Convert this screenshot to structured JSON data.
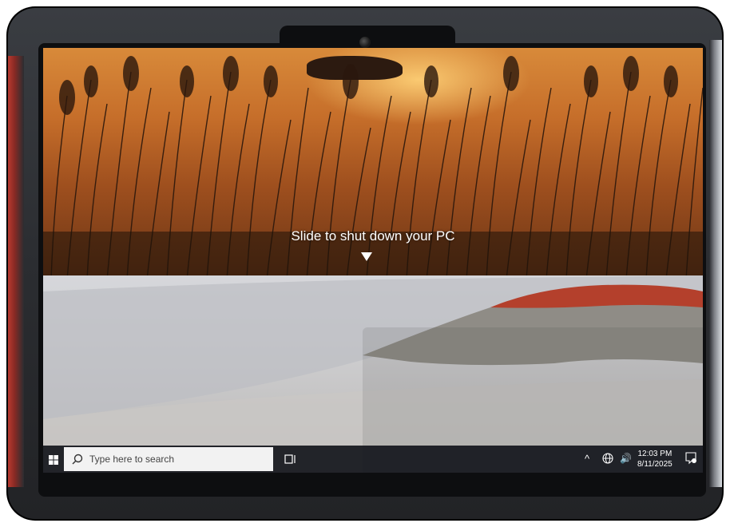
{
  "lock_screen": {
    "shutdown_prompt": "Slide to shut down your PC"
  },
  "taskbar": {
    "search_placeholder": "Type here to search",
    "clock_time": "12:03 PM",
    "clock_date": "8/11/2025",
    "tray_chevron": "^"
  },
  "colors": {
    "taskbar_bg": "#14161c",
    "sunset_accent": "#d88a3a",
    "dune_tone": "#cfcfd1"
  },
  "icons": {
    "start": "windows-logo-icon",
    "search": "search-icon",
    "task_view": "task-view-icon",
    "network": "network-globe-icon",
    "volume": "volume-icon",
    "notifications": "notification-icon"
  }
}
